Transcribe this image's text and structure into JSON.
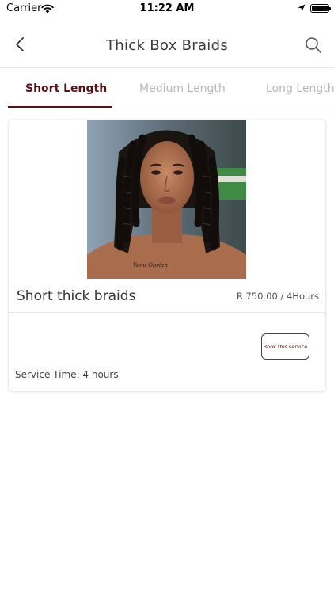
{
  "status_bar": {
    "carrier": "Carrier",
    "time": "11:22 AM"
  },
  "nav": {
    "title": "Thick Box Braids",
    "back_icon": "chevron-left-icon",
    "search_icon": "search-icon"
  },
  "tabs": [
    {
      "label": "Short Length",
      "active": true
    },
    {
      "label": "Medium Length",
      "active": false
    },
    {
      "label": "Long Length",
      "active": false
    }
  ],
  "service": {
    "image": "braided-hair-portrait-photo",
    "name": "Short thick braids",
    "price": "R 750.00 / 4Hours",
    "book_label": "Book this service",
    "service_time": "Service Time: 4 hours"
  },
  "colors": {
    "accent": "#5a0f12",
    "inactive_tab": "#b8b8b8",
    "title_text": "#3b3b3b",
    "divider": "#e7e7e7"
  }
}
